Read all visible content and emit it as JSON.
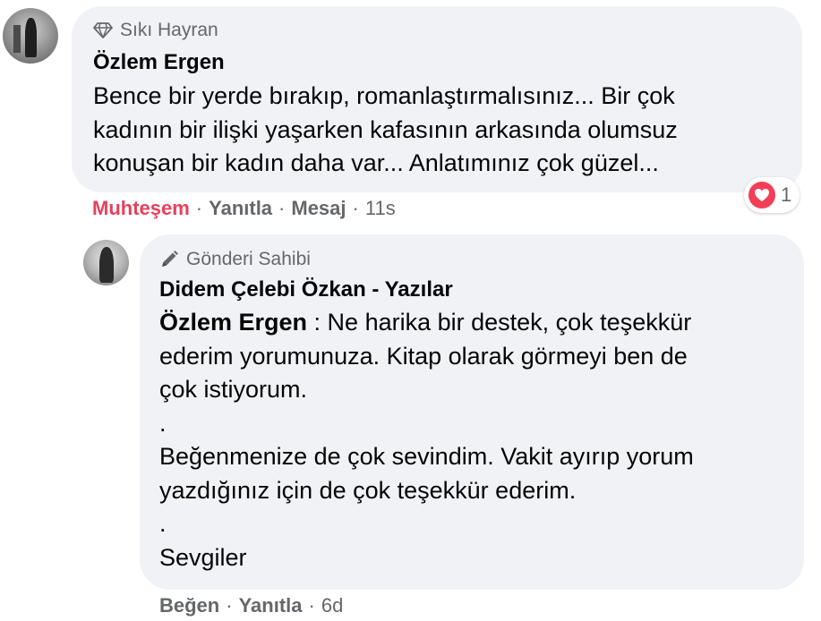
{
  "colors": {
    "bubble_bg": "#f0f2f5",
    "reaction_red": "#e7405c",
    "muted_text": "#65676b",
    "heart_bg": "#f33e58"
  },
  "comment": {
    "badge_icon": "diamond-icon",
    "badge": "Sıkı Hayran",
    "author": "Özlem Ergen",
    "lines": [
      "Bence bir yerde bırakıp, romanlaştırmalısınız... Bir çok",
      "kadının bir ilişki yaşarken kafasının arkasında olumsuz",
      "konuşan bir kadın daha var... Anlatımınız çok güzel..."
    ],
    "actions": {
      "reaction": "Muhteşem",
      "reply": "Yanıtla",
      "message": "Mesaj",
      "time": "11s"
    },
    "reaction_icon": "heart-icon",
    "reaction_count": "1"
  },
  "reply": {
    "badge_icon": "pen-icon",
    "badge": "Gönderi Sahibi",
    "author": "Didem Çelebi Özkan - Yazılar",
    "mention": "Özlem Ergen",
    "line1_rest": " : Ne harika bir destek, çok teşekkür",
    "line2": "ederim yorumunuza. Kitap olarak görmeyi ben de",
    "line3": "çok istiyorum.",
    "line4": ".",
    "line5": "Beğenmenize de çok sevindim. Vakit ayırıp yorum",
    "line6": "yazdığınız için de çok teşekkür ederim.",
    "line7": ".",
    "line8": "Sevgiler",
    "actions": {
      "like": "Beğen",
      "reply": "Yanıtla",
      "time": "6d"
    }
  },
  "separator": "·"
}
